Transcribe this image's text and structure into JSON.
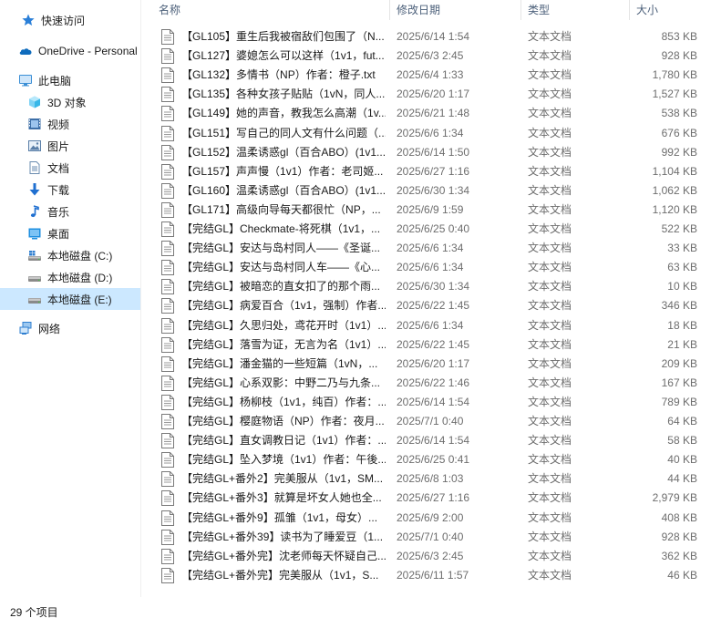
{
  "sidebar": {
    "items": [
      {
        "label": "快速访问",
        "icon": "star-icon",
        "color": "#2a7fd8"
      },
      {
        "label": "OneDrive - Personal",
        "icon": "onedrive-cloud-icon",
        "color": "#0f6cbd"
      },
      {
        "label": "此电脑",
        "icon": "computer-icon",
        "color": "#3b8fd6"
      },
      {
        "label": "3D 对象",
        "icon": "3d-objects-icon",
        "color": "#38b7e8"
      },
      {
        "label": "视频",
        "icon": "video-icon",
        "color": "#3d6fa8"
      },
      {
        "label": "图片",
        "icon": "pictures-icon",
        "color": "#5a7fa8"
      },
      {
        "label": "文档",
        "icon": "documents-icon",
        "color": "#6b8cb0"
      },
      {
        "label": "下载",
        "icon": "download-icon",
        "color": "#1f6fd0"
      },
      {
        "label": "音乐",
        "icon": "music-icon",
        "color": "#1f6fd0"
      },
      {
        "label": "桌面",
        "icon": "desktop-icon",
        "color": "#1f8fe0"
      },
      {
        "label": "本地磁盘 (C:)",
        "icon": "windows-drive-icon",
        "color": "#5a5a5a"
      },
      {
        "label": "本地磁盘 (D:)",
        "icon": "drive-icon",
        "color": "#5a5a5a"
      },
      {
        "label": "本地磁盘 (E:)",
        "icon": "drive-icon",
        "color": "#5a5a5a",
        "selected": true
      },
      {
        "label": "网络",
        "icon": "network-icon",
        "color": "#2f7fd0"
      }
    ]
  },
  "columns": {
    "name": "名称",
    "date": "修改日期",
    "type": "类型",
    "size": "大小"
  },
  "files": [
    {
      "name": "【GL105】重生后我被宿敌们包围了（N...",
      "date": "2025/6/14 1:54",
      "type": "文本文档",
      "size": "853 KB"
    },
    {
      "name": "【GL127】婆媳怎么可以这样（1v1，fut...",
      "date": "2025/6/3 2:45",
      "type": "文本文档",
      "size": "928 KB"
    },
    {
      "name": "【GL132】多情书（NP）作者：橙子.txt",
      "date": "2025/6/4 1:33",
      "type": "文本文档",
      "size": "1,780 KB"
    },
    {
      "name": "【GL135】各种女孩子贴贴（1vN，同人...",
      "date": "2025/6/20 1:17",
      "type": "文本文档",
      "size": "1,527 KB"
    },
    {
      "name": "【GL149】她的声音，教我怎么高潮（1v...",
      "date": "2025/6/21 1:48",
      "type": "文本文档",
      "size": "538 KB"
    },
    {
      "name": "【GL151】写自己的同人文有什么问题（...",
      "date": "2025/6/6 1:34",
      "type": "文本文档",
      "size": "676 KB"
    },
    {
      "name": "【GL152】温柔诱惑gl（百合ABO）(1v1...",
      "date": "2025/6/14 1:50",
      "type": "文本文档",
      "size": "992 KB"
    },
    {
      "name": "【GL157】声声慢（1v1）作者：老司姬...",
      "date": "2025/6/27 1:16",
      "type": "文本文档",
      "size": "1,104 KB"
    },
    {
      "name": "【GL160】温柔诱惑gl（百合ABO）(1v1...",
      "date": "2025/6/30 1:34",
      "type": "文本文档",
      "size": "1,062 KB"
    },
    {
      "name": "【GL171】高级向导每天都很忙（NP，...",
      "date": "2025/6/9 1:59",
      "type": "文本文档",
      "size": "1,120 KB"
    },
    {
      "name": "【完结GL】Checkmate-将死棋（1v1，...",
      "date": "2025/6/25 0:40",
      "type": "文本文档",
      "size": "522 KB"
    },
    {
      "name": "【完结GL】安达与岛村同人——《圣诞...",
      "date": "2025/6/6 1:34",
      "type": "文本文档",
      "size": "33 KB"
    },
    {
      "name": "【完结GL】安达与岛村同人车——《心...",
      "date": "2025/6/6 1:34",
      "type": "文本文档",
      "size": "63 KB"
    },
    {
      "name": "【完结GL】被暗恋的直女扣了的那个雨...",
      "date": "2025/6/30 1:34",
      "type": "文本文档",
      "size": "10 KB"
    },
    {
      "name": "【完结GL】病爱百合（1v1，强制）作者...",
      "date": "2025/6/22 1:45",
      "type": "文本文档",
      "size": "346 KB"
    },
    {
      "name": "【完结GL】久思归处，鸢花开时（1v1）...",
      "date": "2025/6/6 1:34",
      "type": "文本文档",
      "size": "18 KB"
    },
    {
      "name": "【完结GL】落雪为证，无言为名（1v1）...",
      "date": "2025/6/22 1:45",
      "type": "文本文档",
      "size": "21 KB"
    },
    {
      "name": "【完结GL】潘金猫的一些短篇（1vN，...",
      "date": "2025/6/20 1:17",
      "type": "文本文档",
      "size": "209 KB"
    },
    {
      "name": "【完结GL】心系双影：中野二乃与九条...",
      "date": "2025/6/22 1:46",
      "type": "文本文档",
      "size": "167 KB"
    },
    {
      "name": "【完结GL】杨柳枝（1v1，纯百）作者：...",
      "date": "2025/6/14 1:54",
      "type": "文本文档",
      "size": "789 KB"
    },
    {
      "name": "【完结GL】樱庭物语（NP）作者：夜月...",
      "date": "2025/7/1 0:40",
      "type": "文本文档",
      "size": "64 KB"
    },
    {
      "name": "【完结GL】直女调教日记（1v1）作者：...",
      "date": "2025/6/14 1:54",
      "type": "文本文档",
      "size": "58 KB"
    },
    {
      "name": "【完结GL】坠入梦境（1v1）作者：午後...",
      "date": "2025/6/25 0:41",
      "type": "文本文档",
      "size": "40 KB"
    },
    {
      "name": "【完结GL+番外2】完美服从（1v1，SM...",
      "date": "2025/6/8 1:03",
      "type": "文本文档",
      "size": "44 KB"
    },
    {
      "name": "【完结GL+番外3】就算是坏女人她也全...",
      "date": "2025/6/27 1:16",
      "type": "文本文档",
      "size": "2,979 KB"
    },
    {
      "name": "【完结GL+番外9】孤雏（1v1，母女）...",
      "date": "2025/6/9 2:00",
      "type": "文本文档",
      "size": "408 KB"
    },
    {
      "name": "【完结GL+番外39】读书为了睡爱豆（1...",
      "date": "2025/7/1 0:40",
      "type": "文本文档",
      "size": "928 KB"
    },
    {
      "name": "【完结GL+番外完】沈老师每天怀疑自己...",
      "date": "2025/6/3 2:45",
      "type": "文本文档",
      "size": "362 KB"
    },
    {
      "name": "【完结GL+番外完】完美服从（1v1，S...",
      "date": "2025/6/11 1:57",
      "type": "文本文档",
      "size": "46 KB"
    }
  ],
  "status": {
    "item_count": "29 个项目"
  }
}
